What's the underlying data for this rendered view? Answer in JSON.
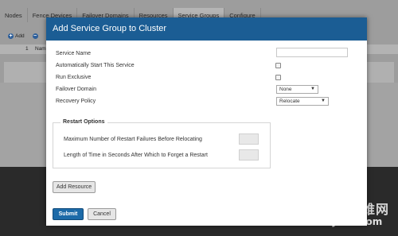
{
  "background": {
    "tabs": [
      "Nodes",
      "Fence Devices",
      "Failover Domains",
      "Resources",
      "Service Groups",
      "Configure"
    ],
    "active_tab_index": 4,
    "toolbar": {
      "add_label": "Add"
    },
    "row": {
      "index": "1",
      "name": "Nam"
    }
  },
  "modal": {
    "title": "Add Service Group to Cluster",
    "fields": {
      "service_name": {
        "label": "Service Name",
        "value": ""
      },
      "auto_start": {
        "label": "Automatically Start This Service",
        "checked": false
      },
      "run_exclusive": {
        "label": "Run Exclusive",
        "checked": false
      },
      "failover_domain": {
        "label": "Failover Domain",
        "selected": "None"
      },
      "recovery_policy": {
        "label": "Recovery Policy",
        "selected": "Relocate"
      }
    },
    "restart_options": {
      "legend": "Restart Options",
      "max_failures_label": "Maximum Number of Restart Failures Before Relocating",
      "max_failures_value": "",
      "forget_label": "Length of Time in Seconds After Which to Forget a Restart",
      "forget_value": ""
    },
    "buttons": {
      "add_resource": "Add Resource",
      "submit": "Submit",
      "cancel": "Cancel"
    }
  },
  "watermark": {
    "cn": "运维网",
    "url": "iyunv.com"
  },
  "colors": {
    "header_blue": "#1b5d94",
    "submit_blue": "#1c6aa8"
  }
}
